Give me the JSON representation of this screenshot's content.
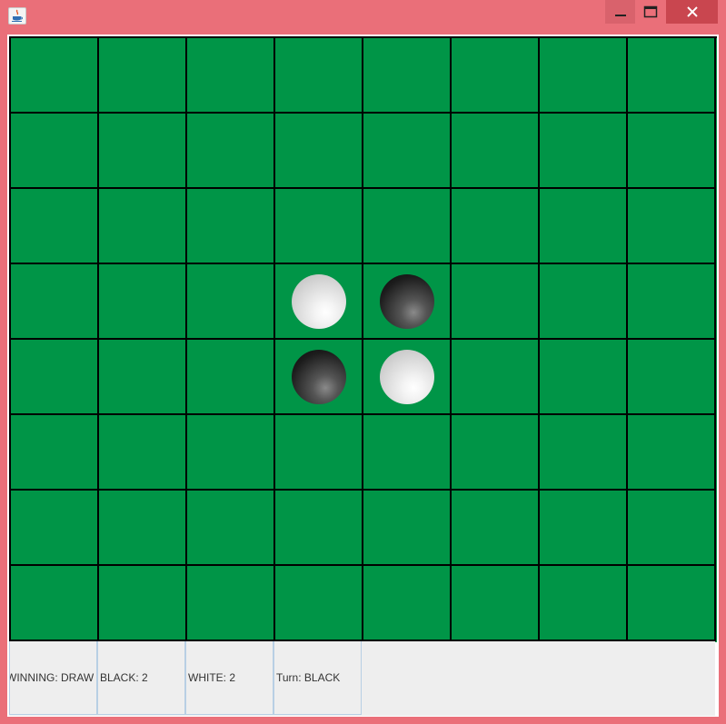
{
  "window": {
    "title": "",
    "colors": {
      "frame": "#ea6f79",
      "close": "#c9464f",
      "board": "#009547",
      "grid": "#000000"
    }
  },
  "board": {
    "rows": 8,
    "cols": 8,
    "cells": [
      [
        "",
        "",
        "",
        "",
        "",
        "",
        "",
        ""
      ],
      [
        "",
        "",
        "",
        "",
        "",
        "",
        "",
        ""
      ],
      [
        "",
        "",
        "",
        "",
        "",
        "",
        "",
        ""
      ],
      [
        "",
        "",
        "",
        "white",
        "black",
        "",
        "",
        ""
      ],
      [
        "",
        "",
        "",
        "black",
        "white",
        "",
        "",
        ""
      ],
      [
        "",
        "",
        "",
        "",
        "",
        "",
        "",
        ""
      ],
      [
        "",
        "",
        "",
        "",
        "",
        "",
        "",
        ""
      ],
      [
        "",
        "",
        "",
        "",
        "",
        "",
        "",
        ""
      ]
    ]
  },
  "status": {
    "winning": "WINNING: DRAW",
    "black": "BLACK: 2",
    "white": "WHITE: 2",
    "turn": "Turn: BLACK"
  }
}
